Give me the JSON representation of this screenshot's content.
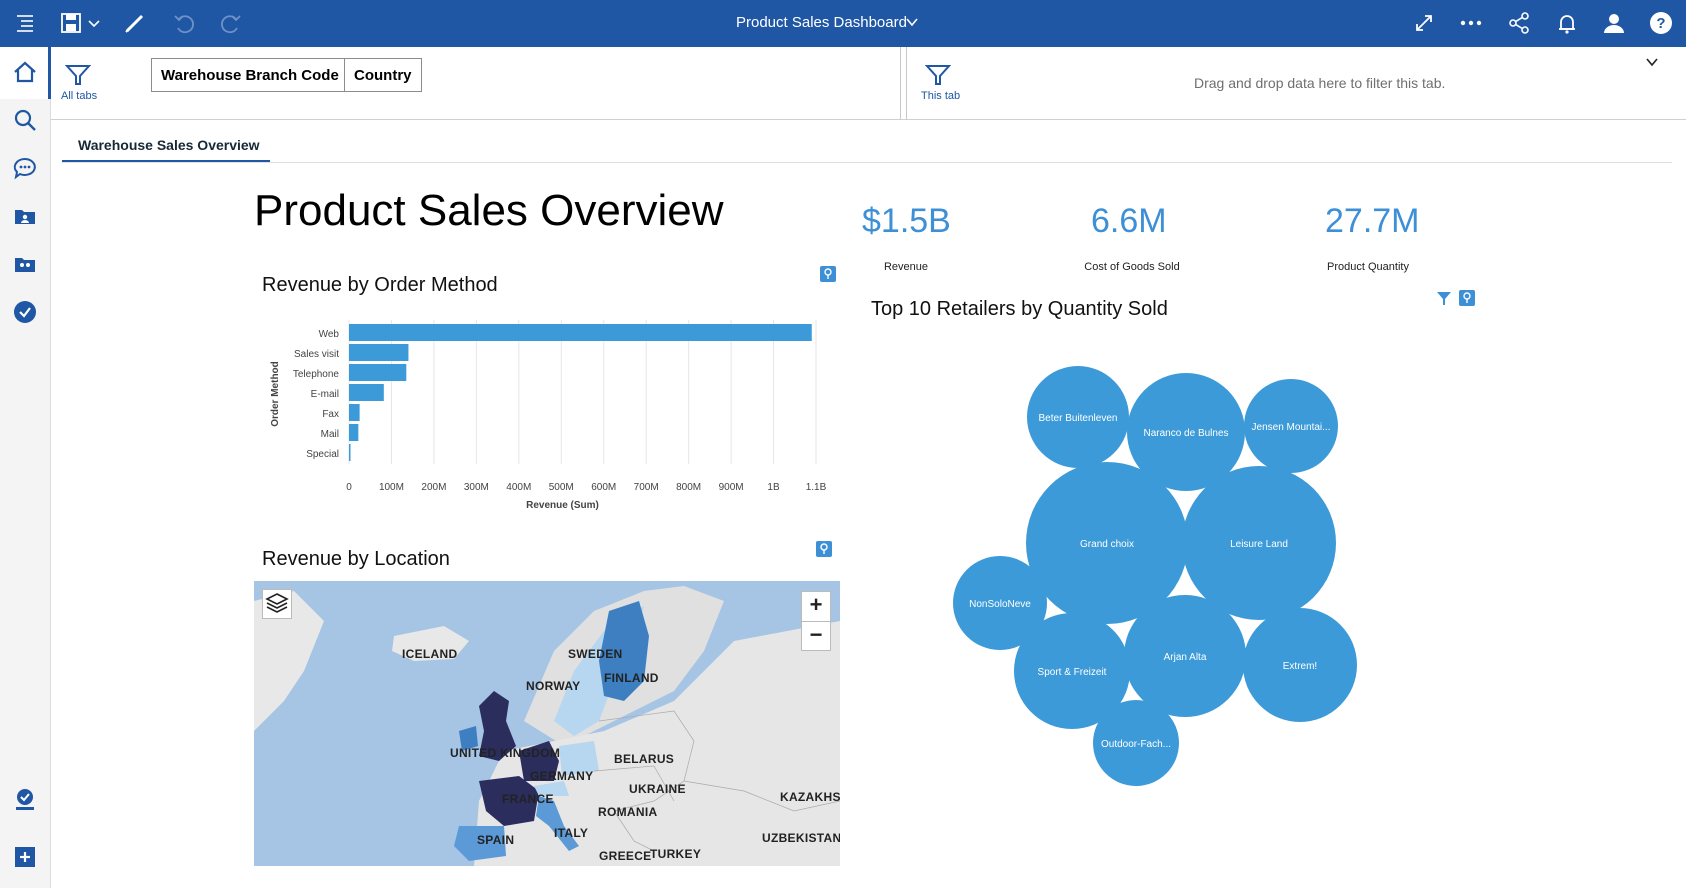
{
  "app": {
    "title": "Product Sales Dashboard"
  },
  "filters": {
    "all_tabs_label": "All tabs",
    "chips": [
      "Warehouse Branch Code",
      "Country"
    ],
    "this_tab_label": "This tab",
    "drop_hint": "Drag and drop data here to filter this tab."
  },
  "tabs": [
    {
      "label": "Warehouse Sales Overview",
      "active": true
    }
  ],
  "page": {
    "title": "Product Sales Overview"
  },
  "kpis": [
    {
      "value": "$1.5B",
      "label": "Revenue"
    },
    {
      "value": "6.6M",
      "label": "Cost of Goods Sold"
    },
    {
      "value": "27.7M",
      "label": "Product Quantity"
    }
  ],
  "widgets": {
    "revenue_by_order_method": "Revenue by Order Method",
    "revenue_by_location": "Revenue by Location",
    "top_retailers": "Top 10 Retailers by Quantity Sold"
  },
  "map": {
    "labels": [
      "ICELAND",
      "SWEDEN",
      "FINLAND",
      "NORWAY",
      "UNITED KINGDOM",
      "GERMANY",
      "BELARUS",
      "UKRAINE",
      "FRANCE",
      "KAZAKHSTA",
      "ROMANIA",
      "SPAIN",
      "ITALY",
      "UZBEKISTAN",
      "GREECE",
      "TURKEY"
    ],
    "zoom_in": "+",
    "zoom_out": "−"
  },
  "colors": {
    "brand": "#1f57a4",
    "accent": "#3d8fd6",
    "bar": "#3d9ad8",
    "bubble": "#3d9ad8",
    "map_dark": "#2b2d5c",
    "map_mid": "#3d7fc0",
    "map_light": "#b7d6f0"
  },
  "icons": {
    "topbar_left": [
      "menu-icon",
      "save-icon",
      "chevron-down-icon",
      "edit-icon",
      "undo-icon",
      "redo-icon"
    ],
    "topbar_right": [
      "expand-icon",
      "more-icon",
      "share-icon",
      "notifications-icon",
      "user-icon",
      "help-icon"
    ],
    "leftnav": [
      "home-icon",
      "search-icon",
      "chat-icon",
      "my-content-icon",
      "team-content-icon",
      "recent-icon",
      "profile-icon",
      "new-icon"
    ]
  },
  "chart_data": [
    {
      "type": "bar",
      "title": "Revenue by Order Method",
      "orientation": "horizontal",
      "categories": [
        "Web",
        "Sales visit",
        "Telephone",
        "E-mail",
        "Fax",
        "Mail",
        "Special"
      ],
      "values": [
        1090000000,
        140000000,
        135000000,
        82000000,
        25000000,
        22000000,
        3000000
      ],
      "xlabel": "Revenue (Sum)",
      "ylabel": "Order Method",
      "xticks": [
        "0",
        "100M",
        "200M",
        "300M",
        "400M",
        "500M",
        "600M",
        "700M",
        "800M",
        "900M",
        "1B",
        "1.1B"
      ],
      "xlim": [
        0,
        1100000000
      ],
      "grid": true
    },
    {
      "type": "bubble",
      "title": "Top 10 Retailers by Quantity Sold",
      "categories": [
        "Beter Buitenleven",
        "Naranco de Bulnes",
        "Jensen Mountai...",
        "Grand choix",
        "Leisure Land",
        "NonSoloNeve",
        "Sport & Freizeit",
        "Arjan Alta",
        "Extrem!",
        "Outdoor-Fach..."
      ],
      "values": [
        100,
        125,
        80,
        230,
        210,
        75,
        115,
        125,
        110,
        65
      ]
    }
  ]
}
